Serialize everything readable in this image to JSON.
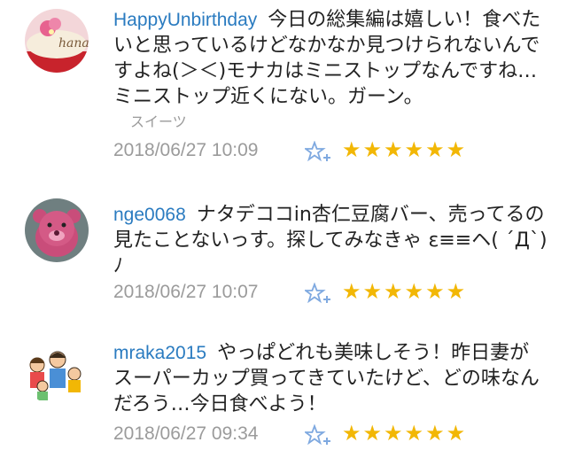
{
  "comments": [
    {
      "user": "HappyUnbirthday",
      "text": "今日の総集編は嬉しい！食べたいと思っているけどなかなか見つけられないんですよね(＞＜)モナカはミニストップなんですね…ミニストップ近くにない。ガーン。",
      "tag": "スイーツ",
      "date": "2018/06/27 10:09",
      "stars": "★★★★★★",
      "avatar_text": "hana"
    },
    {
      "user": "nge0068",
      "text": "ナタデココin杏仁豆腐バー、売ってるの見たことないっす。探してみなきゃ ε≡≡ヘ( ´Д`)ﾉ",
      "date": "2018/06/27 10:07",
      "stars": "★★★★★★"
    },
    {
      "user": "mraka2015",
      "text": "やっぱどれも美味しそう！昨日妻がスーパーカップ買ってきていたけど、どの味なんだろう…今日食べよう！",
      "date": "2018/06/27 09:34",
      "stars": "★★★★★★"
    }
  ],
  "colors": {
    "username": "#2a7bc0",
    "star": "#f2b705",
    "date": "#9b9b9b",
    "fav_icon": "#7fa9e0"
  },
  "icons": {
    "favorite": "star-plus-icon",
    "rating": "star-rating-icon"
  }
}
